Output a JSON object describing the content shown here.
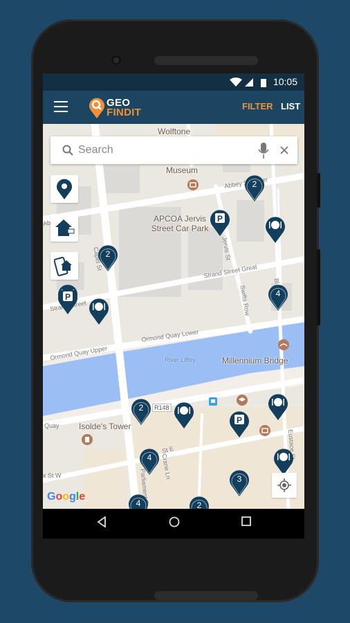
{
  "status_bar": {
    "time": "10:05",
    "icons": [
      "wifi-icon",
      "signal-icon",
      "battery-icon"
    ]
  },
  "app_bar": {
    "logo_top": "GEO",
    "logo_bottom": "FINDIT",
    "filter_label": "FILTER",
    "list_label": "LIST",
    "colors": {
      "bar": "#1b4561",
      "accent": "#f0913a"
    }
  },
  "search": {
    "placeholder": "Search",
    "value": ""
  },
  "tools": [
    "location-pin-icon",
    "home-icon",
    "mobile-home-icon"
  ],
  "map": {
    "labels": {
      "wolftone": "Wolftone",
      "museum": "Museum",
      "carpark": "APCOA Jervis Street Car Park",
      "bridge": "Millennium Bridge",
      "tower": "Isolde's Tower",
      "river": "River Liffey",
      "r148": "R148"
    },
    "streets": {
      "abbey": "Abbey St Upper",
      "abbey2": "Abb",
      "jervis": "Jervis St",
      "strand_great": "Strand Street Great",
      "swifts": "Swifts Row",
      "strand": "Strand Street",
      "ormond_lower": "Ormond Quay Lower",
      "ormond_upper": "Ormond Quay Upper",
      "quay": "Quay",
      "capel": "Capel St",
      "bl": "Bl",
      "essex": "St E",
      "crane": "Crane Ln",
      "parliament": "Parliament St",
      "eustace": "Eustace St",
      "essex_w": "x St W"
    },
    "markers": [
      {
        "type": "cluster",
        "count": "2"
      },
      {
        "type": "parking"
      },
      {
        "type": "restaurant"
      },
      {
        "type": "cluster",
        "count": "2"
      },
      {
        "type": "restaurant"
      },
      {
        "type": "cluster",
        "count": "4"
      },
      {
        "type": "parking"
      },
      {
        "type": "restaurant"
      },
      {
        "type": "cluster",
        "count": "2"
      },
      {
        "type": "restaurant"
      },
      {
        "type": "restaurant"
      },
      {
        "type": "parking"
      },
      {
        "type": "cluster",
        "count": "4"
      },
      {
        "type": "restaurant"
      },
      {
        "type": "cluster",
        "count": "3"
      },
      {
        "type": "cluster",
        "count": "4"
      },
      {
        "type": "cluster",
        "count": "2"
      }
    ],
    "attribution": "Google",
    "marker_color": "#143f5c"
  },
  "nav": [
    "back-icon",
    "home-icon",
    "recents-icon"
  ]
}
